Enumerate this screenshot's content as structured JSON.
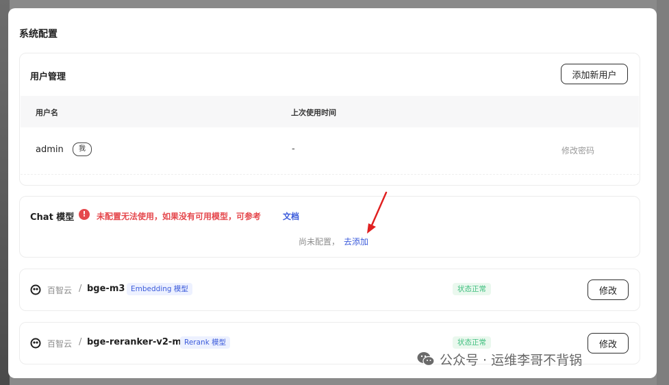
{
  "modal": {
    "title": "系统配置"
  },
  "users": {
    "title": "用户管理",
    "add_button": "添加新用户",
    "columns": [
      "用户名",
      "上次使用时间"
    ],
    "rows": [
      {
        "username": "admin",
        "badge": "我",
        "last_used": "-",
        "action": "修改密码"
      }
    ]
  },
  "chat_model": {
    "title": "Chat 模型",
    "warning_icon": "!",
    "warning": "未配置无法使用，如果没有可用模型，可参考",
    "doc_link": "文档",
    "empty_text": "尚未配置，",
    "add_link": "去添加"
  },
  "models": [
    {
      "provider": "百智云",
      "separator": "/",
      "name": "bge-m3",
      "tag": "Embedding 模型",
      "status": "状态正常",
      "action": "修改"
    },
    {
      "provider": "百智云",
      "separator": "/",
      "name": "bge-reranker-v2-m3",
      "tag": "Rerank 模型",
      "status": "状态正常",
      "action": "修改"
    }
  ],
  "watermark": {
    "text": "公众号 · 运维李哥不背锅",
    "icon": "wechat-icon"
  },
  "colors": {
    "accent": "#3b5bdb",
    "danger": "#e5484d",
    "success": "#3fbf7f",
    "arrow": "#e02020"
  }
}
